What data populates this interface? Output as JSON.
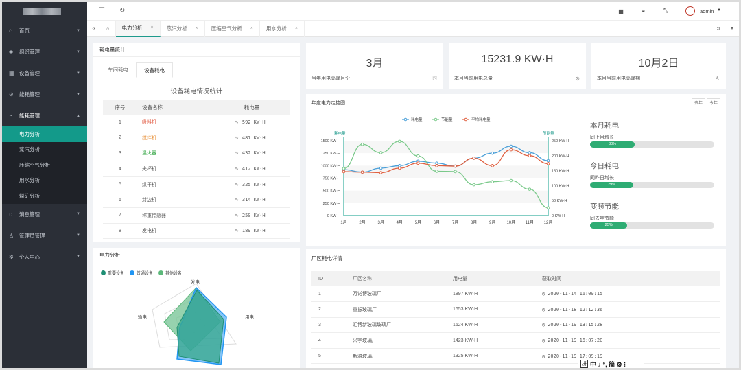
{
  "sidebar": {
    "items": [
      {
        "icon": "home-icon",
        "glyph": "⌂",
        "label": "首页"
      },
      {
        "icon": "tag-icon",
        "glyph": "◈",
        "label": "组织管理"
      },
      {
        "icon": "grid-icon",
        "glyph": "▦",
        "label": "设备管理"
      },
      {
        "icon": "circle-check-icon",
        "glyph": "⊘",
        "label": "能耗管理"
      },
      {
        "icon": "dashboard-icon",
        "glyph": "◔",
        "label": "能耗管理",
        "open": true,
        "children": [
          "电力分析",
          "蒸汽分析",
          "压缩空气分析",
          "用水分析",
          "煤矿分析"
        ]
      },
      {
        "icon": "bell-icon",
        "glyph": "◌",
        "label": "消息管理"
      },
      {
        "icon": "user-icon",
        "glyph": "♙",
        "label": "管理员管理"
      },
      {
        "icon": "gear-icon",
        "glyph": "✲",
        "label": "个人中心"
      }
    ]
  },
  "topbar": {
    "user": "admin"
  },
  "tabs": [
    {
      "label": "电力分析",
      "active": true
    },
    {
      "label": "蒸汽分析"
    },
    {
      "label": "压缩空气分析"
    },
    {
      "label": "用水分析"
    }
  ],
  "consumption": {
    "title": "耗电量统计",
    "subtabs": [
      "车间耗电",
      "设备耗电"
    ],
    "table_title": "设备耗电情况统计",
    "headers": [
      "序号",
      "设备名称",
      "耗电量"
    ],
    "rows": [
      {
        "no": "1",
        "name": "吸料机",
        "value": "592 KW·H",
        "color": "#e0533a"
      },
      {
        "no": "2",
        "name": "搅拌机",
        "value": "487 KW·H",
        "color": "#e8913a"
      },
      {
        "no": "3",
        "name": "温火器",
        "value": "432 KW·H",
        "color": "#3aa84a"
      },
      {
        "no": "4",
        "name": "夹杯机",
        "value": "412 KW·H",
        "color": "#555555"
      },
      {
        "no": "5",
        "name": "烘干机",
        "value": "325 KW·H",
        "color": "#555555"
      },
      {
        "no": "6",
        "name": "封边机",
        "value": "314 KW·H",
        "color": "#555555"
      },
      {
        "no": "7",
        "name": "称重传感器",
        "value": "250 KW·H",
        "color": "#555555"
      },
      {
        "no": "8",
        "name": "发电机",
        "value": "189 KW·H",
        "color": "#555555"
      }
    ]
  },
  "stats": [
    {
      "value": "3月",
      "label": "当年用电高峰月份",
      "icon": "bookmark-icon",
      "glyph": "⎘"
    },
    {
      "value": "15231.9 KW·H",
      "label": "本月当前用电总量",
      "icon": "compass-icon",
      "glyph": "⊘"
    },
    {
      "value": "10月2日",
      "label": "本月当前用电高峰期",
      "icon": "user-icon",
      "glyph": "♙"
    }
  ],
  "trend": {
    "title": "年度电力走势图",
    "buttons": [
      "去年",
      "今年"
    ],
    "side": [
      {
        "title": "本月耗电",
        "sub": "同上月增长",
        "percent": 30,
        "label": "30%"
      },
      {
        "title": "今日耗电",
        "sub": "同昨日增长",
        "percent": 29,
        "label": "29%"
      },
      {
        "title": "变频节能",
        "sub": "同去年节能",
        "percent": 25,
        "label": "25%"
      }
    ]
  },
  "chart_data": [
    {
      "type": "line",
      "categories": [
        "1月",
        "2月",
        "3月",
        "4月",
        "5月",
        "6月",
        "7月",
        "8月",
        "9月",
        "10月",
        "11月",
        "12月"
      ],
      "ylabel_left": "耗电量",
      "ylabel_right": "节能量",
      "yticks_left": [
        "1500 KW·H",
        "1250 KW·H",
        "1000 KW·H",
        "750 KW·H",
        "500 KW·H",
        "250 KW·H",
        "0 KW·H"
      ],
      "yticks_right": [
        "250 KW·H",
        "200 KW·H",
        "150 KW·H",
        "100 KW·H",
        "50 KW·H",
        "0 KW·H"
      ],
      "ylim_left": [
        0,
        1500
      ],
      "ylim_right": [
        0,
        250
      ],
      "legend": "top-center",
      "grid": true,
      "series": [
        {
          "name": "耗电量",
          "axis": "left",
          "color": "#4a9fd8",
          "values": [
            920,
            870,
            950,
            1000,
            1090,
            1050,
            990,
            1150,
            1250,
            1390,
            1260,
            1100
          ]
        },
        {
          "name": "节能量",
          "axis": "right",
          "color": "#7ac98a",
          "values": [
            157,
            238,
            210,
            248,
            199,
            148,
            147,
            103,
            113,
            117,
            88,
            26
          ]
        },
        {
          "name": "平均耗电量",
          "axis": "left",
          "color": "#e06040",
          "values": [
            880,
            870,
            860,
            950,
            1050,
            1000,
            990,
            1150,
            1000,
            1320,
            1200,
            1040
          ]
        }
      ]
    },
    {
      "type": "radar",
      "title": "电力分析",
      "indicators": [
        "发电",
        "用电",
        "输电"
      ],
      "legend": "top-left",
      "series": [
        {
          "name": "重要设备",
          "color": "#1f8f74"
        },
        {
          "name": "普通设备",
          "color": "#2196f3"
        },
        {
          "name": "其他设备",
          "color": "#5cb87a"
        }
      ]
    }
  ],
  "radar": {
    "title": "电力分析",
    "labels": {
      "fa": "发电",
      "yong": "用电",
      "shu": "输电"
    }
  },
  "factory": {
    "title": "厂区耗电详情",
    "headers": [
      "ID",
      "厂区名称",
      "用电量",
      "获取时间"
    ],
    "rows": [
      {
        "id": "1",
        "name": "万诺博玻璃厂",
        "value": "1897 KW·H",
        "time": "2020-11-14 16:09:15"
      },
      {
        "id": "2",
        "name": "重振玻璃厂",
        "value": "1653 KW·H",
        "time": "2020-11-18 12:12:36"
      },
      {
        "id": "3",
        "name": "汇博新玻璃玻璃厂",
        "value": "1524 KW·H",
        "time": "2020-11-19 13:15:28"
      },
      {
        "id": "4",
        "name": "兴宇玻璃厂",
        "value": "1423 KW·H",
        "time": "2020-11-19 16:07:20"
      },
      {
        "id": "5",
        "name": "新雅玻璃厂",
        "value": "1325 KW·H",
        "time": "2020-11-19 17:09:19"
      }
    ]
  },
  "ime": {
    "label": "拼",
    "text": "中 ♪ °, 简 ⚙ ⁝"
  }
}
